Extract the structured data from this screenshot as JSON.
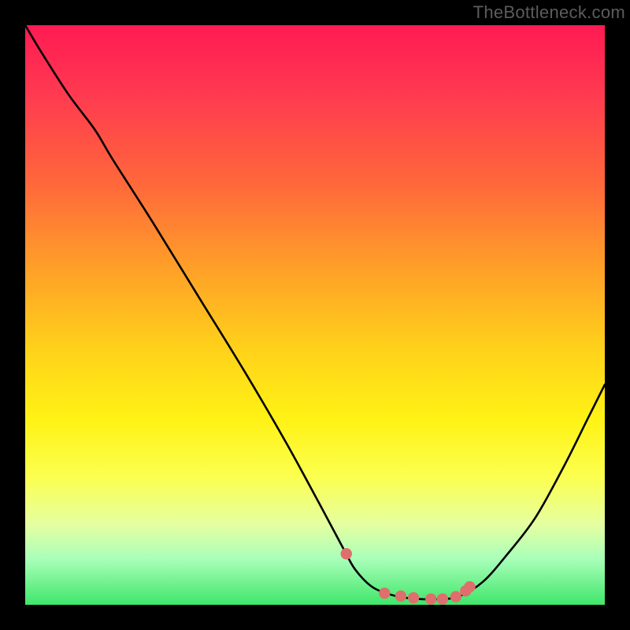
{
  "watermark": {
    "text": "TheBottleneck.com"
  },
  "chart_data": {
    "type": "line",
    "title": "",
    "xlabel": "",
    "ylabel": "",
    "xlim": [
      0,
      100
    ],
    "ylim": [
      0,
      100
    ],
    "series": [
      {
        "name": "curve",
        "x": [
          0.0,
          3.0,
          7.5,
          12.0,
          15.0,
          22.0,
          30.0,
          38.0,
          45.0,
          51.0,
          55.0,
          57.0,
          60.0,
          64.0,
          68.0,
          72.0,
          75.0,
          79.0,
          83.0,
          88.0,
          93.0,
          97.0,
          100.0
        ],
        "values": [
          100,
          95,
          88,
          82,
          77,
          66,
          53,
          40,
          28,
          17,
          9.5,
          6.0,
          3.0,
          1.5,
          1.0,
          1.0,
          1.5,
          4.0,
          8.5,
          15,
          24,
          32,
          38
        ]
      },
      {
        "name": "markers",
        "x": [
          55.4,
          62.0,
          64.8,
          67.0,
          70.0,
          72.0,
          74.3,
          76.0,
          76.7
        ],
        "values": [
          8.8,
          2.0,
          1.5,
          1.2,
          1.0,
          1.0,
          1.4,
          2.4,
          3.1
        ]
      }
    ],
    "marker_color": "#de6f6c",
    "background_gradient": "red-yellow-green"
  }
}
